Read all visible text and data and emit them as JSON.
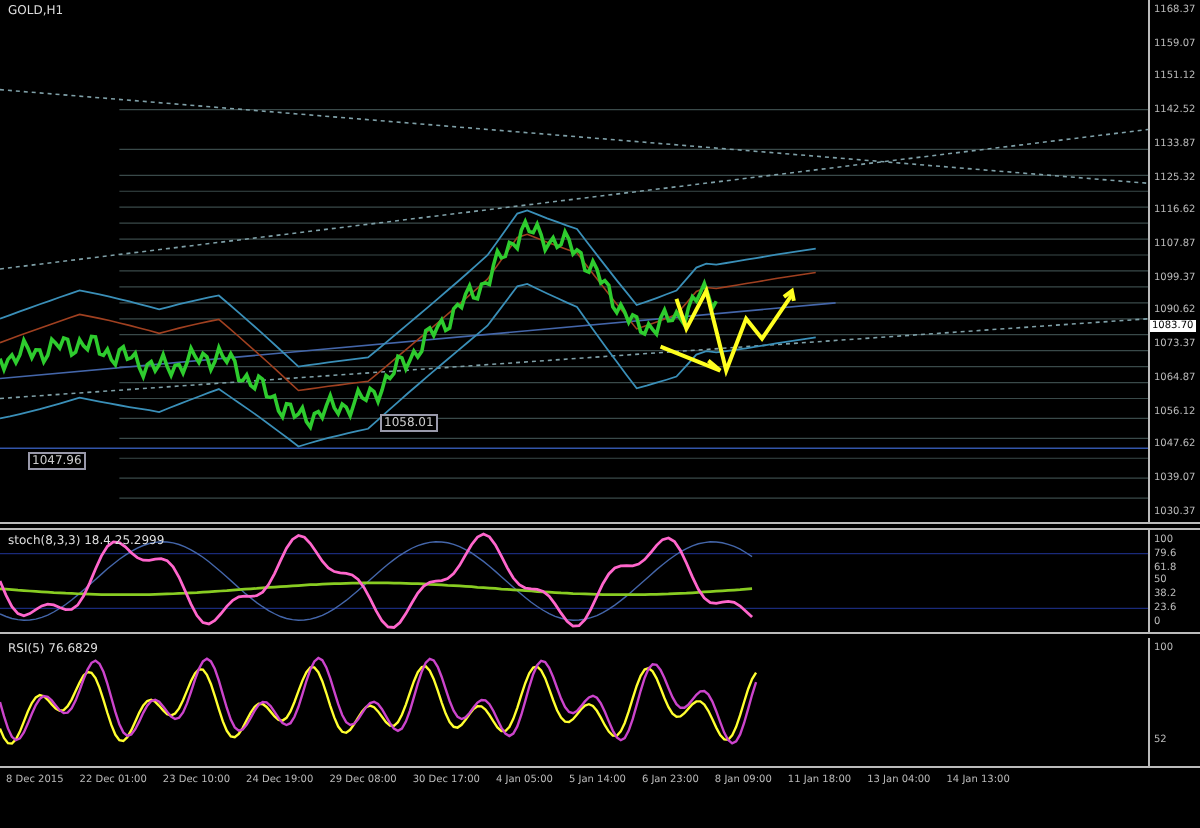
{
  "chart": {
    "title": "GOLD,H1",
    "price_axis": [
      "1168.37",
      "1159.07",
      "1151.12",
      "1142.52",
      "1133.87",
      "1125.32",
      "1116.62",
      "1107.87",
      "1099.37",
      "1090.62",
      "1073.37",
      "1064.87",
      "1056.12",
      "1047.62",
      "1039.07",
      "1030.37"
    ],
    "current_price": "1083.70",
    "price_labels": [
      "1058.01",
      "1047.96"
    ]
  },
  "stochastic": {
    "title": "stoch(8,3,3) 18.4 25.2999",
    "axis": [
      "100",
      "79.6",
      "61.8",
      "50",
      "38.2",
      "23.6",
      "0"
    ]
  },
  "rsi": {
    "title": "RSI(5) 76.6829",
    "axis": [
      "100",
      "52"
    ]
  },
  "time_axis": [
    "8 Dec 2015",
    "22 Dec 01:00",
    "23 Dec 10:00",
    "24 Dec 19:00",
    "29 Dec 08:00",
    "30 Dec 17:00",
    "4 Jan 05:00",
    "5 Jan 14:00",
    "6 Jan 23:00",
    "8 Jan 09:00",
    "11 Jan 18:00",
    "13 Jan 04:00",
    "14 Jan 13:00"
  ]
}
